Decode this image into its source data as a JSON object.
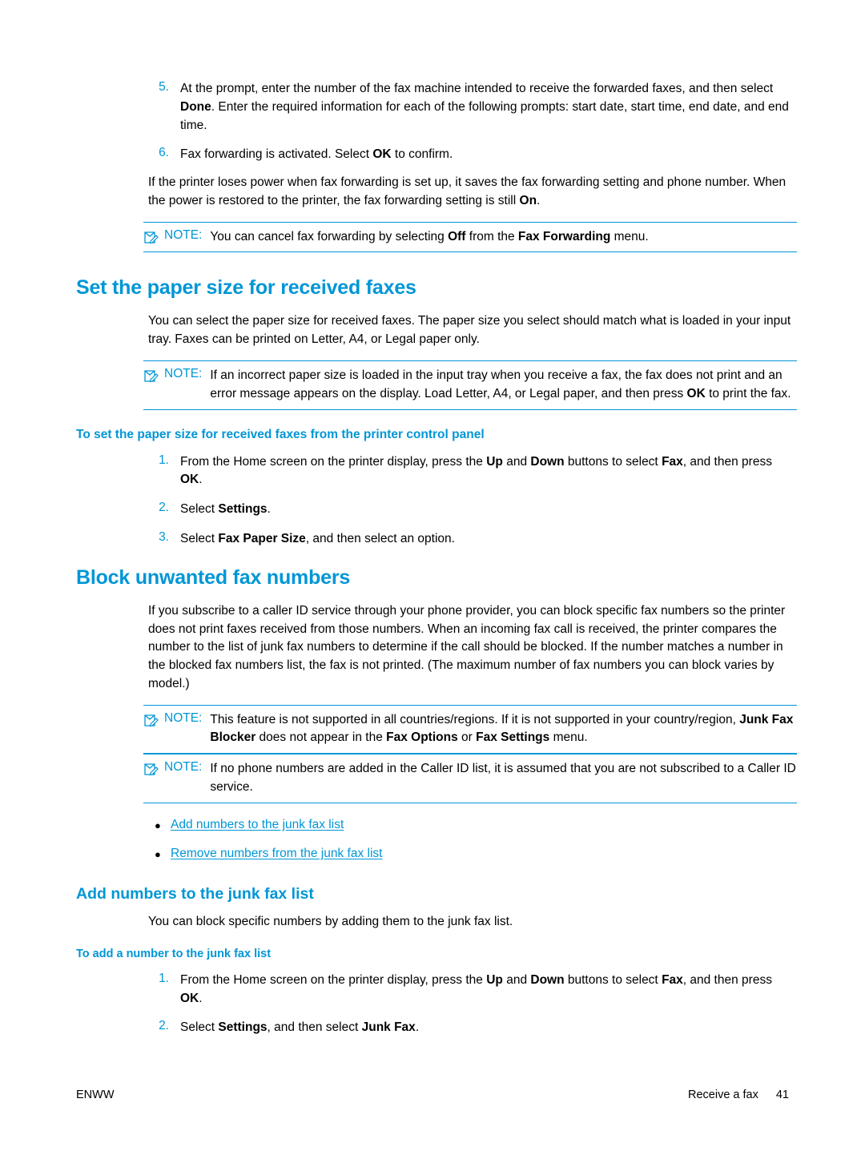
{
  "colors": {
    "accent": "#0096d6",
    "text": "#000000"
  },
  "steps_top": [
    {
      "num": "5.",
      "parts": [
        {
          "t": "At the prompt, enter the number of the fax machine intended to receive the forwarded faxes, and then select ",
          "b": false
        },
        {
          "t": "Done",
          "b": true
        },
        {
          "t": ". Enter the required information for each of the following prompts: start date, start time, end date, and end time.",
          "b": false
        }
      ]
    },
    {
      "num": "6.",
      "parts": [
        {
          "t": "Fax forwarding is activated. Select ",
          "b": false
        },
        {
          "t": "OK",
          "b": true
        },
        {
          "t": " to confirm.",
          "b": false
        }
      ]
    }
  ],
  "paragraph_power": {
    "parts": [
      {
        "t": "If the printer loses power when fax forwarding is set up, it saves the fax forwarding setting and phone number. When the power is restored to the printer, the fax forwarding setting is still ",
        "b": false
      },
      {
        "t": "On",
        "b": true
      },
      {
        "t": ".",
        "b": false
      }
    ]
  },
  "note1": {
    "label": "NOTE:",
    "parts": [
      {
        "t": "You can cancel fax forwarding by selecting ",
        "b": false
      },
      {
        "t": "Off",
        "b": true
      },
      {
        "t": " from the ",
        "b": false
      },
      {
        "t": "Fax Forwarding",
        "b": true
      },
      {
        "t": " menu.",
        "b": false
      }
    ]
  },
  "heading_paper_size": "Set the paper size for received faxes",
  "paragraph_paper_size": {
    "parts": [
      {
        "t": "You can select the paper size for received faxes. The paper size you select should match what is loaded in your input tray. Faxes can be printed on Letter, A4, or Legal paper only.",
        "b": false
      }
    ]
  },
  "note2": {
    "label": "NOTE:",
    "parts": [
      {
        "t": "If an incorrect paper size is loaded in the input tray when you receive a fax, the fax does not print and an error message appears on the display. Load Letter, A4, or Legal paper, and then press ",
        "b": false
      },
      {
        "t": "OK",
        "b": true
      },
      {
        "t": " to print the fax.",
        "b": false
      }
    ]
  },
  "subheading_control_panel": "To set the paper size for received faxes from the printer control panel",
  "steps_paper_size": [
    {
      "num": "1.",
      "parts": [
        {
          "t": "From the Home screen on the printer display, press the ",
          "b": false
        },
        {
          "t": "Up",
          "b": true
        },
        {
          "t": " and ",
          "b": false
        },
        {
          "t": "Down",
          "b": true
        },
        {
          "t": " buttons to select ",
          "b": false
        },
        {
          "t": "Fax",
          "b": true
        },
        {
          "t": ", and then press ",
          "b": false
        },
        {
          "t": "OK",
          "b": true
        },
        {
          "t": ".",
          "b": false
        }
      ]
    },
    {
      "num": "2.",
      "parts": [
        {
          "t": "Select ",
          "b": false
        },
        {
          "t": "Settings",
          "b": true
        },
        {
          "t": ".",
          "b": false
        }
      ]
    },
    {
      "num": "3.",
      "parts": [
        {
          "t": "Select ",
          "b": false
        },
        {
          "t": "Fax Paper Size",
          "b": true
        },
        {
          "t": ", and then select an option.",
          "b": false
        }
      ]
    }
  ],
  "heading_block": "Block unwanted fax numbers",
  "paragraph_block": {
    "parts": [
      {
        "t": "If you subscribe to a caller ID service through your phone provider, you can block specific fax numbers so the printer does not print faxes received from those numbers. When an incoming fax call is received, the printer compares the number to the list of junk fax numbers to determine if the call should be blocked. If the number matches a number in the blocked fax numbers list, the fax is not printed. (The maximum number of fax numbers you can block varies by model.)",
        "b": false
      }
    ]
  },
  "note3": {
    "label": "NOTE:",
    "parts": [
      {
        "t": "This feature is not supported in all countries/regions. If it is not supported in your country/region, ",
        "b": false
      },
      {
        "t": "Junk Fax Blocker",
        "b": true
      },
      {
        "t": " does not appear in the ",
        "b": false
      },
      {
        "t": "Fax Options",
        "b": true
      },
      {
        "t": " or ",
        "b": false
      },
      {
        "t": "Fax Settings",
        "b": true
      },
      {
        "t": " menu.",
        "b": false
      }
    ]
  },
  "note4": {
    "label": "NOTE:",
    "parts": [
      {
        "t": "If no phone numbers are added in the Caller ID list, it is assumed that you are not subscribed to a Caller ID service.",
        "b": false
      }
    ]
  },
  "bullets": [
    {
      "dot": "●",
      "label": "Add numbers to the junk fax list"
    },
    {
      "dot": "●",
      "label": "Remove numbers from the junk fax list"
    }
  ],
  "heading_add_numbers": "Add numbers to the junk fax list",
  "paragraph_add_numbers": {
    "parts": [
      {
        "t": "You can block specific numbers by adding them to the junk fax list.",
        "b": false
      }
    ]
  },
  "subheading_add_number": "To add a number to the junk fax list",
  "steps_add_number": [
    {
      "num": "1.",
      "parts": [
        {
          "t": "From the Home screen on the printer display, press the ",
          "b": false
        },
        {
          "t": "Up",
          "b": true
        },
        {
          "t": " and ",
          "b": false
        },
        {
          "t": "Down",
          "b": true
        },
        {
          "t": " buttons to select ",
          "b": false
        },
        {
          "t": "Fax",
          "b": true
        },
        {
          "t": ", and then press ",
          "b": false
        },
        {
          "t": "OK",
          "b": true
        },
        {
          "t": ".",
          "b": false
        }
      ]
    },
    {
      "num": "2.",
      "parts": [
        {
          "t": "Select ",
          "b": false
        },
        {
          "t": "Settings",
          "b": true
        },
        {
          "t": ", and then select ",
          "b": false
        },
        {
          "t": "Junk Fax",
          "b": true
        },
        {
          "t": ".",
          "b": false
        }
      ]
    }
  ],
  "footer": {
    "left": "ENWW",
    "section": "Receive a fax",
    "page_number": "41"
  }
}
